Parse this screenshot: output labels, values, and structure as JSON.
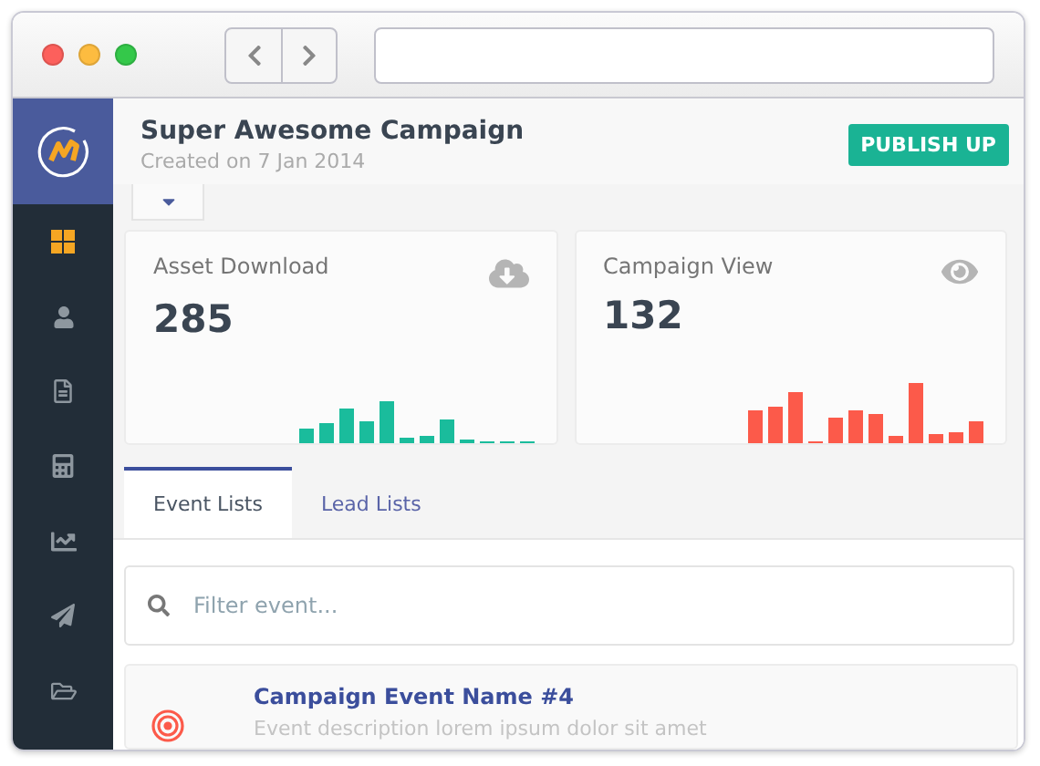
{
  "sidebar": {
    "items": [
      {
        "kind": "grid",
        "selected": true
      },
      {
        "kind": "user",
        "selected": false
      },
      {
        "kind": "document",
        "selected": false
      },
      {
        "kind": "calculator",
        "selected": false
      },
      {
        "kind": "chart",
        "selected": false
      },
      {
        "kind": "plane",
        "selected": false
      },
      {
        "kind": "folder",
        "selected": false
      }
    ]
  },
  "header": {
    "title": "Super Awesome Campaign",
    "subtitle": "Created on 7 Jan 2014",
    "button": "PUBLISH UP",
    "menu_expanded": false
  },
  "stats": [
    {
      "kind": "download",
      "label": "Asset Download",
      "value": "285",
      "color": "#1abc9c"
    },
    {
      "kind": "view",
      "label": "Campaign View",
      "value": "132",
      "color": "#fc5a4a"
    }
  ],
  "tabs": [
    {
      "label": "Event Lists",
      "selected": true
    },
    {
      "label": "Lead Lists",
      "selected": false
    }
  ],
  "filter": {
    "placeholder": "Filter event..."
  },
  "events": [
    {
      "title": "Campaign Event Name #4",
      "description": "Event description lorem ipsum dolor sit amet"
    }
  ]
}
